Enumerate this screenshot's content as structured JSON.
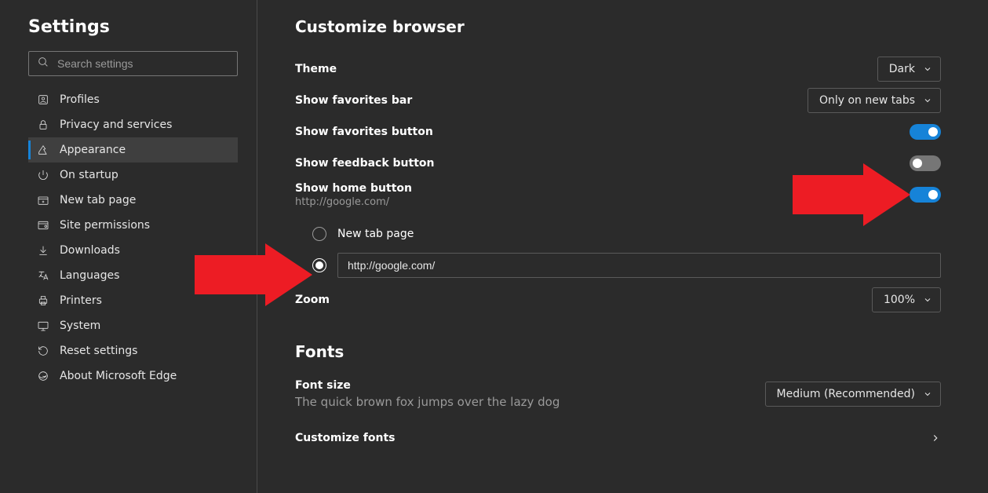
{
  "sidebar": {
    "title": "Settings",
    "search_placeholder": "Search settings",
    "items": [
      {
        "label": "Profiles"
      },
      {
        "label": "Privacy and services"
      },
      {
        "label": "Appearance"
      },
      {
        "label": "On startup"
      },
      {
        "label": "New tab page"
      },
      {
        "label": "Site permissions"
      },
      {
        "label": "Downloads"
      },
      {
        "label": "Languages"
      },
      {
        "label": "Printers"
      },
      {
        "label": "System"
      },
      {
        "label": "Reset settings"
      },
      {
        "label": "About Microsoft Edge"
      }
    ]
  },
  "customize": {
    "heading": "Customize browser",
    "theme_label": "Theme",
    "theme_value": "Dark",
    "favorites_bar_label": "Show favorites bar",
    "favorites_bar_value": "Only on new tabs",
    "favorites_button_label": "Show favorites button",
    "favorites_button_on": true,
    "feedback_button_label": "Show feedback button",
    "feedback_button_on": false,
    "home_button_label": "Show home button",
    "home_button_sub": "http://google.com/",
    "home_button_on": true,
    "home_radio": {
      "new_tab_label": "New tab page",
      "url_value": "http://google.com/"
    },
    "zoom_label": "Zoom",
    "zoom_value": "100%"
  },
  "fonts": {
    "heading": "Fonts",
    "font_size_label": "Font size",
    "font_size_value": "Medium (Recommended)",
    "preview": "The quick brown fox jumps over the lazy dog",
    "customize_fonts_label": "Customize fonts"
  }
}
